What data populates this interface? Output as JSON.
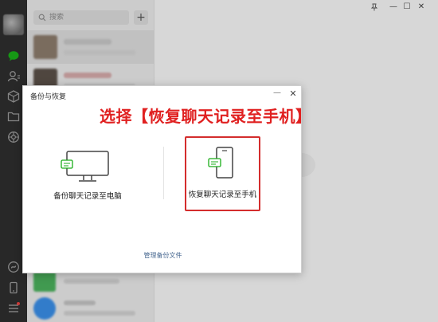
{
  "search": {
    "placeholder": "搜索"
  },
  "add_button": {
    "label": "+"
  },
  "sidebar": {
    "icons": [
      "chat-icon",
      "contacts-icon",
      "favorites-icon",
      "files-icon",
      "moments-icon",
      "mini-program-icon",
      "phone-icon",
      "menu-icon"
    ],
    "accent_color": "#07c160"
  },
  "window_controls": {
    "pin": "pin-icon",
    "minimize": "—",
    "maximize": "☐",
    "close": "✕"
  },
  "dialog": {
    "title": "备份与恢复",
    "minimize": "—",
    "close": "✕",
    "instruction": "选择【恢复聊天记录至手机】",
    "options": [
      {
        "label": "备份聊天记录至电脑",
        "icon": "computer-icon"
      },
      {
        "label": "恢复聊天记录至手机",
        "icon": "phone-icon",
        "selected": true
      }
    ],
    "manage_link": "管理备份文件",
    "highlight_color": "#d42d2d"
  }
}
